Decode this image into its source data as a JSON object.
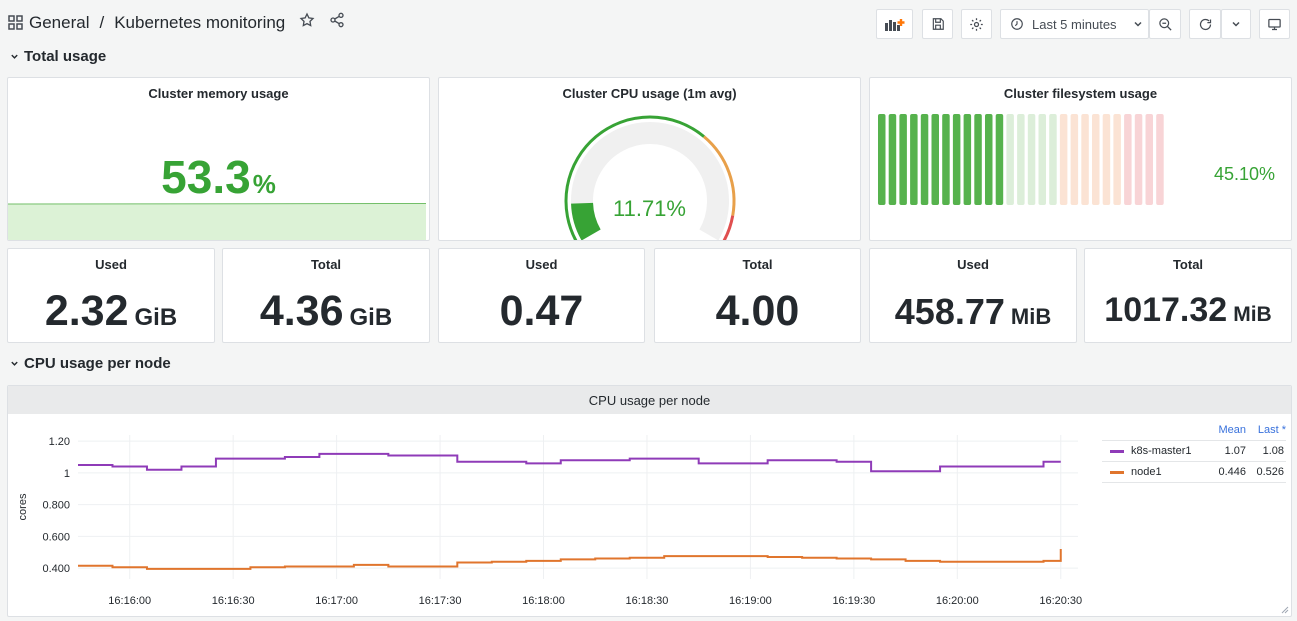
{
  "header": {
    "folder": "General",
    "separator": "/",
    "dashboard_title": "Kubernetes monitoring",
    "time_range": "Last 5 minutes"
  },
  "rows": {
    "total_usage": "Total usage",
    "cpu_per_node": "CPU usage per node"
  },
  "panels": {
    "memory": {
      "title": "Cluster memory usage",
      "value": "53.3",
      "unit": "%"
    },
    "cpu": {
      "title": "Cluster CPU usage (1m avg)",
      "value": "11.71%",
      "gauge_fraction": 0.1171
    },
    "filesystem": {
      "title": "Cluster filesystem usage",
      "value": "45.10%",
      "fraction": 0.451
    },
    "mem_used": {
      "title": "Used",
      "value": "2.32",
      "unit": "GiB"
    },
    "mem_total": {
      "title": "Total",
      "value": "4.36",
      "unit": "GiB"
    },
    "cpu_used": {
      "title": "Used",
      "value": "0.47",
      "unit": ""
    },
    "cpu_total": {
      "title": "Total",
      "value": "4.00",
      "unit": ""
    },
    "fs_used": {
      "title": "Used",
      "value": "458.77",
      "unit": "MiB"
    },
    "fs_total": {
      "title": "Total",
      "value": "1017.32",
      "unit": "MiB"
    }
  },
  "graph": {
    "title": "CPU usage per node",
    "legend_headers": {
      "mean": "Mean",
      "last": "Last *"
    },
    "legend": [
      {
        "name": "k8s-master1",
        "mean": "1.07",
        "last": "1.08",
        "color": "#8f3bb8"
      },
      {
        "name": "node1",
        "mean": "0.446",
        "last": "0.526",
        "color": "#e0752d"
      }
    ]
  },
  "chart_data": {
    "type": "line",
    "title": "CPU usage per node",
    "ylabel": "cores",
    "ylim": [
      0.35,
      1.22
    ],
    "y_ticks": [
      "0.400",
      "0.600",
      "0.800",
      "1",
      "1.20"
    ],
    "y_tick_values": [
      0.4,
      0.6,
      0.8,
      1.0,
      1.2
    ],
    "x_ticks": [
      "16:16:00",
      "16:16:30",
      "16:17:00",
      "16:17:30",
      "16:18:00",
      "16:18:30",
      "16:19:00",
      "16:19:30",
      "16:20:00",
      "16:20:30"
    ],
    "x_step_labels": [
      "16:15:45",
      "16:15:55",
      "16:16:05",
      "16:16:15",
      "16:16:25",
      "16:16:35",
      "16:16:45",
      "16:16:55",
      "16:17:05",
      "16:17:15",
      "16:17:25",
      "16:17:35",
      "16:17:45",
      "16:17:55",
      "16:18:05",
      "16:18:15",
      "16:18:25",
      "16:18:35",
      "16:18:45",
      "16:18:55",
      "16:19:05",
      "16:19:15",
      "16:19:25",
      "16:19:35",
      "16:19:45",
      "16:19:55",
      "16:20:05",
      "16:20:15",
      "16:20:25",
      "16:20:30"
    ],
    "series": [
      {
        "name": "k8s-master1",
        "color": "#8f3bb8",
        "values": [
          1.05,
          1.04,
          1.02,
          1.04,
          1.09,
          1.09,
          1.1,
          1.12,
          1.12,
          1.11,
          1.11,
          1.07,
          1.07,
          1.06,
          1.08,
          1.08,
          1.09,
          1.09,
          1.06,
          1.06,
          1.08,
          1.08,
          1.07,
          1.01,
          1.01,
          1.04,
          1.04,
          1.04,
          1.07,
          1.07
        ]
      },
      {
        "name": "node1",
        "color": "#e0752d",
        "values": [
          0.415,
          0.405,
          0.395,
          0.395,
          0.395,
          0.405,
          0.41,
          0.41,
          0.42,
          0.41,
          0.41,
          0.435,
          0.44,
          0.445,
          0.455,
          0.46,
          0.465,
          0.475,
          0.475,
          0.475,
          0.47,
          0.465,
          0.46,
          0.455,
          0.445,
          0.44,
          0.44,
          0.44,
          0.445,
          0.52
        ]
      }
    ]
  }
}
